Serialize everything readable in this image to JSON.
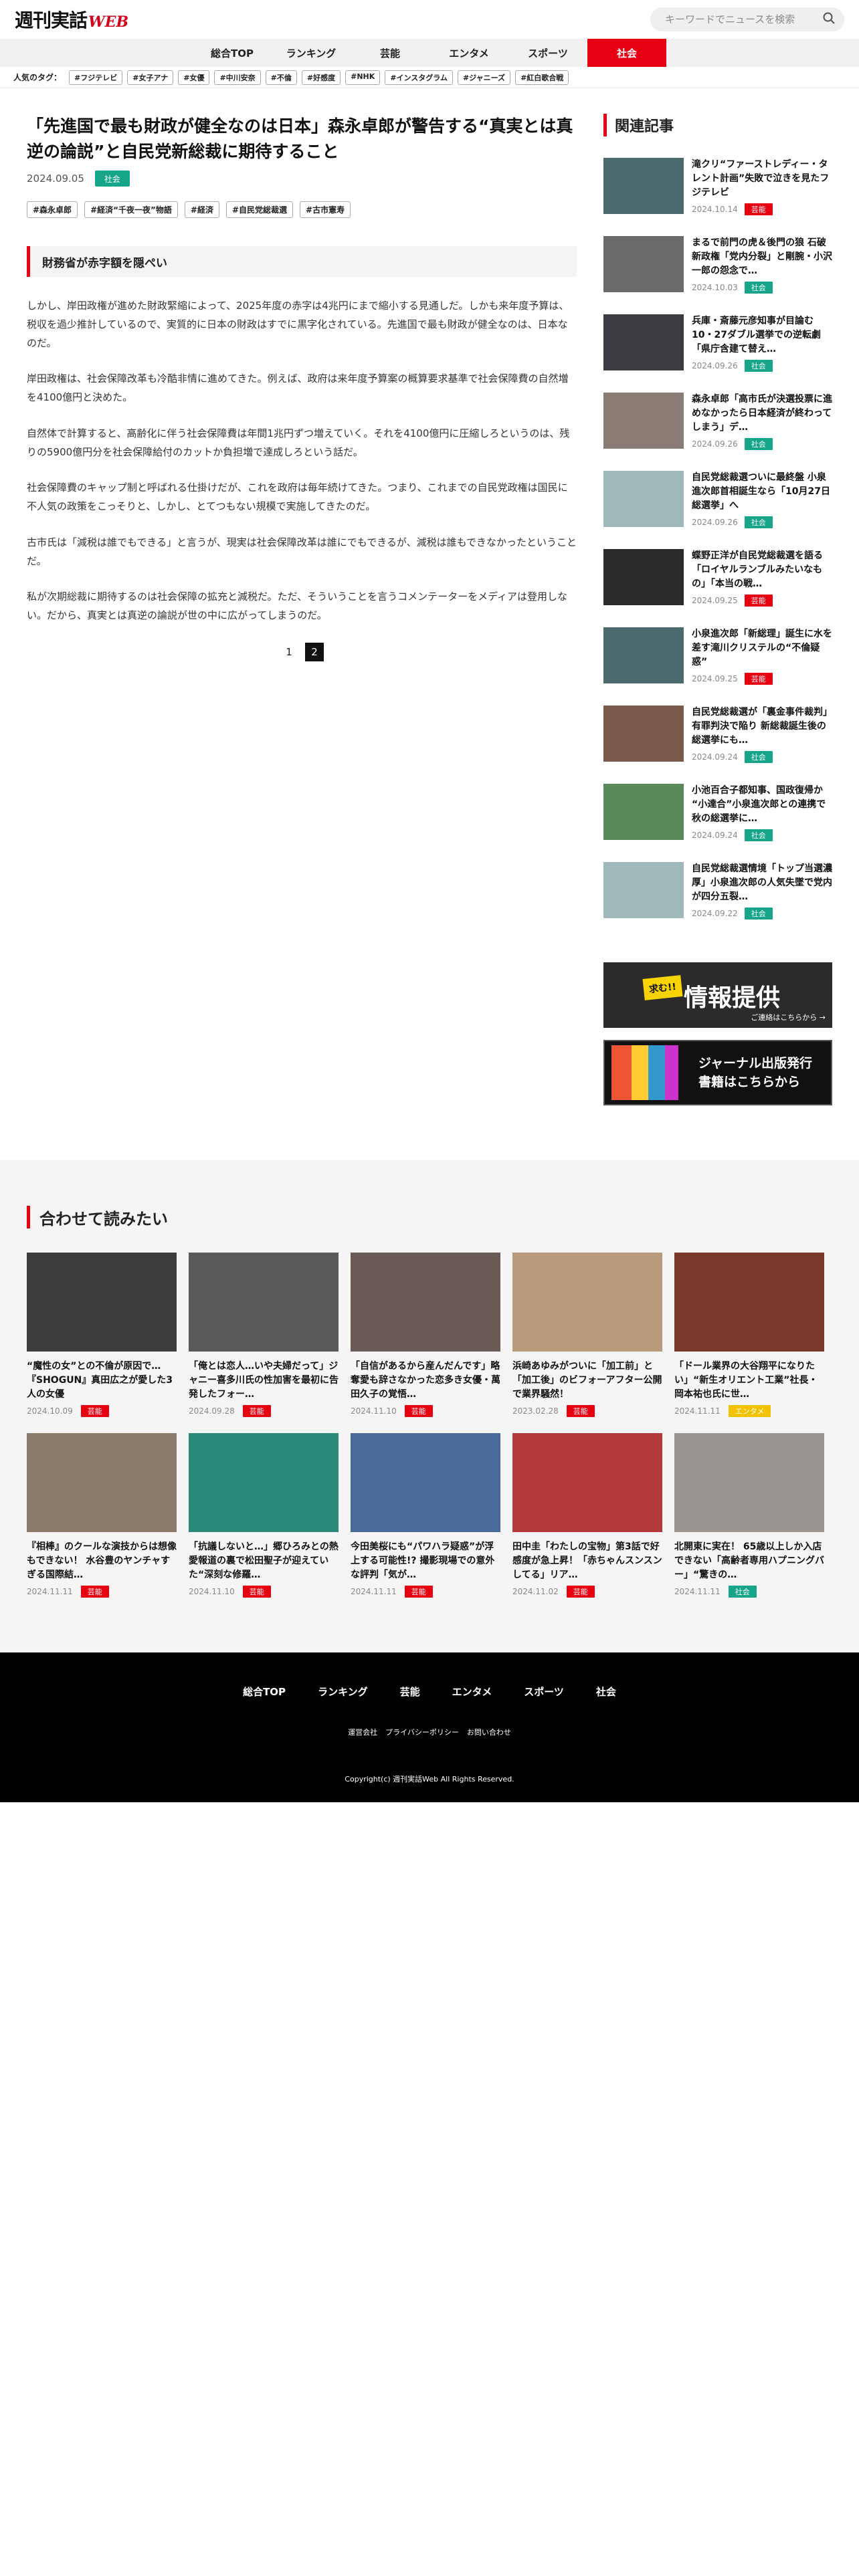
{
  "header": {
    "logo_main": "週刊実話",
    "logo_web": "WEB",
    "search_placeholder": "キーワードでニュースを検索"
  },
  "nav": [
    {
      "label": "総合TOP",
      "active": false
    },
    {
      "label": "ランキング",
      "active": false
    },
    {
      "label": "芸能",
      "active": false
    },
    {
      "label": "エンタメ",
      "active": false
    },
    {
      "label": "スポーツ",
      "active": false
    },
    {
      "label": "社会",
      "active": true
    }
  ],
  "popular_tags": {
    "label": "人気のタグ：",
    "items": [
      "#フジテレビ",
      "#女子アナ",
      "#女優",
      "#中川安奈",
      "#不倫",
      "#好感度",
      "#NHK",
      "#インスタグラム",
      "#ジャニーズ",
      "#紅白歌合戦"
    ]
  },
  "article": {
    "title": "「先進国で最も財政が健全なのは日本」森永卓郎が警告する“真実とは真逆の論説”と自民党新総裁に期待すること",
    "date": "2024.09.05",
    "category": "社会",
    "tags": [
      "#森永卓郎",
      "#経済“千夜一夜”物語",
      "#経済",
      "#自民党総裁選",
      "#古市憲寿"
    ],
    "subheading": "財務省が赤字額を隠ぺい",
    "paragraphs": [
      "しかし、岸田政権が進めた財政緊縮によって、2025年度の赤字は4兆円にまで縮小する見通しだ。しかも来年度予算は、税収を過少推計しているので、実質的に日本の財政はすでに黒字化されている。先進国で最も財政が健全なのは、日本なのだ。",
      "岸田政権は、社会保障改革も冷酷非情に進めてきた。例えば、政府は来年度予算案の概算要求基準で社会保障費の自然増を4100億円と決めた。",
      "自然体で計算すると、高齢化に伴う社会保障費は年間1兆円ずつ増えていく。それを4100億円に圧縮しろというのは、残りの5900億円分を社会保障給付のカットか負担増で達成しろという話だ。",
      "社会保障費のキャップ制と呼ばれる仕掛けだが、これを政府は毎年続けてきた。つまり、これまでの自民党政権は国民に不人気の政策をこっそりと、しかし、とてつもない規模で実施してきたのだ。",
      "古市氏は「減税は誰でもできる」と言うが、現実は社会保障改革は誰にでもできるが、減税は誰もできなかったということだ。",
      "私が次期総裁に期待するのは社会保障の拡充と減税だ。ただ、そういうことを言うコメンテーターをメディアは登用しない。だから、真実とは真逆の論説が世の中に広がってしまうのだ。"
    ],
    "pages": [
      "1",
      "2"
    ],
    "current_page": "2"
  },
  "sidebar": {
    "heading": "関連記事",
    "items": [
      {
        "title": "滝クリ“ファーストレディー・タレント計画”失敗で泣きを見たフジテレビ",
        "date": "2024.10.14",
        "category": "芸能",
        "thumb": "#4a6a6e"
      },
      {
        "title": "まるで前門の虎＆後門の狼 石破新政権「党内分裂」と剛腕・小沢一郎の怨念で…",
        "date": "2024.10.03",
        "category": "社会",
        "thumb": "#6d6a6a"
      },
      {
        "title": "兵庫・斎藤元彦知事が目論む10・27ダブル選挙での逆転劇「県庁含建て替え…",
        "date": "2024.09.26",
        "category": "社会",
        "thumb": "#3a3a40"
      },
      {
        "title": "森永卓郎「高市氏が決選投票に進めなかったら日本経済が終わってしまう」デ…",
        "date": "2024.09.26",
        "category": "社会",
        "thumb": "#8a7b74"
      },
      {
        "title": "自民党総裁選ついに最終盤 小泉進次郎首相誕生なら「10月27日総選挙」へ",
        "date": "2024.09.26",
        "category": "社会",
        "thumb": "#9fb8b9"
      },
      {
        "title": "蝶野正洋が自民党総裁選を語る「ロイヤルランブルみたいなもの」「本当の戦…",
        "date": "2024.09.25",
        "category": "芸能",
        "thumb": "#2a2a2a"
      },
      {
        "title": "小泉進次郎「新総理」誕生に水を差す滝川クリステルの“不倫疑惑”",
        "date": "2024.09.25",
        "category": "芸能",
        "thumb": "#4a6a6e"
      },
      {
        "title": "自民党総裁選が「裏金事件裁判」有罪判決で陥り 新総裁誕生後の総選挙にも…",
        "date": "2024.09.24",
        "category": "社会",
        "thumb": "#7a5a4a"
      },
      {
        "title": "小池百合子都知事、国政復帰か “小達合”小泉進次郎との連携で秋の総選挙に…",
        "date": "2024.09.24",
        "category": "社会",
        "thumb": "#5a8a5a"
      },
      {
        "title": "自民党総裁選情境「トップ当選濃厚」小泉進次郎の人気失墜で党内が四分五裂…",
        "date": "2024.09.22",
        "category": "社会",
        "thumb": "#9fb8b9"
      }
    ],
    "banner1": {
      "tag": "求む!!",
      "text": "情報提供",
      "sub": "ご連絡はこちらから →"
    },
    "banner2": {
      "text_line1": "ジャーナル出版発行",
      "text_line2": "書籍はこちらから"
    }
  },
  "related": {
    "heading": "合わせて読みたい",
    "items": [
      {
        "title": "“魔性の女”との不倫が原因で…『SHOGUN』真田広之が愛した3人の女優",
        "date": "2024.10.09",
        "category": "芸能",
        "thumb": "#3c3c3c"
      },
      {
        "title": "「俺とは恋人…いや夫婦だって」ジャニー喜多川氏の性加害を最初に告発したフォー…",
        "date": "2024.09.28",
        "category": "芸能",
        "thumb": "#5a5a5a"
      },
      {
        "title": "「自信があるから産んだんです」略奪愛も辞さなかった恋多き女優・萬田久子の覚悟…",
        "date": "2024.11.10",
        "category": "芸能",
        "thumb": "#6a5a55"
      },
      {
        "title": "浜崎あゆみがついに「加工前」と「加工後」のビフォーアフター公開で業界騒然！",
        "date": "2023.02.28",
        "category": "芸能",
        "thumb": "#b89a7a"
      },
      {
        "title": "「ドール業界の大谷翔平になりたい」“新生オリエント工業”社長・岡本祐也氏に世…",
        "date": "2024.11.11",
        "category": "エンタメ",
        "thumb": "#7a3a2a"
      },
      {
        "title": "『相棒』のクールな演技からは想像もできない！ 水谷豊のヤンチャすぎる国際結…",
        "date": "2024.11.11",
        "category": "芸能",
        "thumb": "#8a7a6a"
      },
      {
        "title": "「抗議しないと…」郷ひろみとの熱愛報道の裏で松田聖子が迎えていた“深刻な修羅…",
        "date": "2024.11.10",
        "category": "芸能",
        "thumb": "#2a8a7a"
      },
      {
        "title": "今田美桜にも“パワハラ疑惑”が浮上する可能性!? 撮影現場での意外な評判「気が…",
        "date": "2024.11.11",
        "category": "芸能",
        "thumb": "#4a6a9a"
      },
      {
        "title": "田中圭「わたしの宝物」第3話で好感度が急上昇！「赤ちゃんスンスンしてる」リア…",
        "date": "2024.11.02",
        "category": "芸能",
        "thumb": "#b23a3a"
      },
      {
        "title": "北開東に実在！ 65歳以上しか入店できない「高齢者専用ハプニングバー」“驚きの…",
        "date": "2024.11.11",
        "category": "社会",
        "thumb": "#9a9590"
      }
    ]
  },
  "footer": {
    "nav": [
      "総合TOP",
      "ランキング",
      "芸能",
      "エンタメ",
      "スポーツ",
      "社会"
    ],
    "links": [
      "運営会社",
      "プライバシーポリシー",
      "お問い合わせ"
    ],
    "copyright": "Copyright(c) 週刊実話Web All Rights Reserved."
  },
  "colors": {
    "accent": "#e60012",
    "shakai": "#16a589",
    "entame": "#f2c200"
  }
}
